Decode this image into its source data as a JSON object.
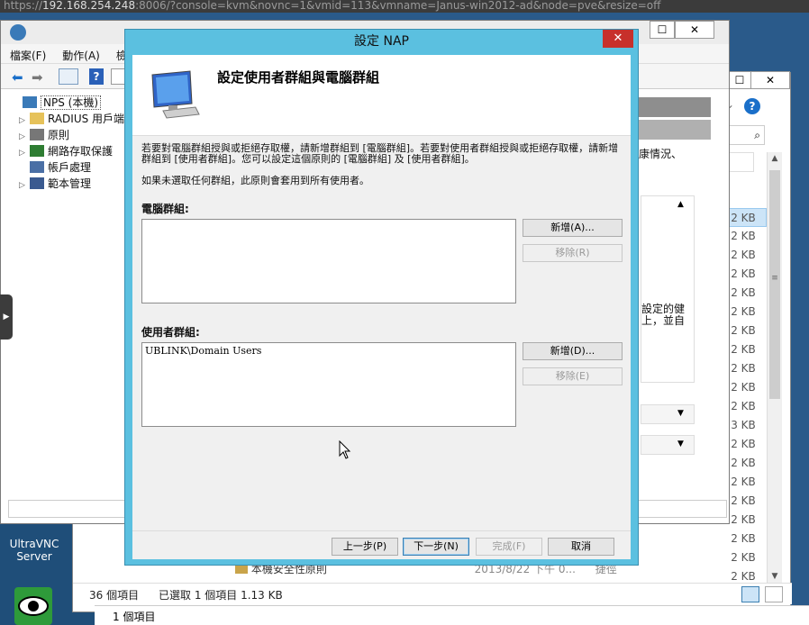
{
  "browser": {
    "url_prefix": "https://",
    "url_host": "192.168.254.248",
    "url_rest": ":8006/?console=kvm&novnc=1&vmid=113&vmname=Janus-win2012-ad&node=pve&resize=off"
  },
  "mmc": {
    "menu": [
      "檔案(F)",
      "動作(A)",
      "檢"
    ],
    "tree": [
      {
        "label": "NPS (本機)",
        "expand": ""
      },
      {
        "label": "RADIUS 用戶端",
        "expand": "▷"
      },
      {
        "label": "原則",
        "expand": "▷"
      },
      {
        "label": "網路存取保護",
        "expand": "▷"
      },
      {
        "label": "帳戶處理",
        "expand": ""
      },
      {
        "label": "範本管理",
        "expand": "▷"
      }
    ],
    "right_text1": "康情況、",
    "right_text2a": "設定的健",
    "right_text2b": "上，並自"
  },
  "explorer": {
    "sizes": [
      "2 KB",
      "2 KB",
      "2 KB",
      "2 KB",
      "2 KB",
      "2 KB",
      "2 KB",
      "2 KB",
      "2 KB",
      "2 KB",
      "2 KB",
      "3 KB",
      "2 KB",
      "2 KB",
      "2 KB",
      "2 KB",
      "2 KB",
      "2 KB",
      "2 KB",
      "2 KB"
    ],
    "partial_row": {
      "name": "本機安全性原則",
      "date": "2013/8/22 下午 0...",
      "type": "捷徑"
    },
    "status_count": "36 個項目",
    "status_selected": "已選取 1 個項目  1.13 KB",
    "status_bottom": "1 個項目"
  },
  "desktop": {
    "vnc_label_1": "UltraVNC",
    "vnc_label_2": "Server"
  },
  "dialog": {
    "title": "設定 NAP",
    "heading": "設定使用者群組與電腦群組",
    "desc1": "若要對電腦群組授與或拒絕存取權，請新增群組到 [電腦群組]。若要對使用者群組授與或拒絕存取權，請新增群組到 [使用者群組]。您可以設定這個原則的 [電腦群組] 及 [使用者群組]。",
    "desc2": "如果未選取任何群組，此原則會套用到所有使用者。",
    "computer_groups_label": "電腦群組:",
    "computer_add": "新增(A)...",
    "computer_remove": "移除(R)",
    "user_groups_label": "使用者群組:",
    "user_groups_items": [
      "UBLINK\\Domain Users"
    ],
    "user_add": "新增(D)...",
    "user_remove": "移除(E)",
    "back": "上一步(P)",
    "next": "下一步(N)",
    "finish": "完成(F)",
    "cancel": "取消"
  }
}
